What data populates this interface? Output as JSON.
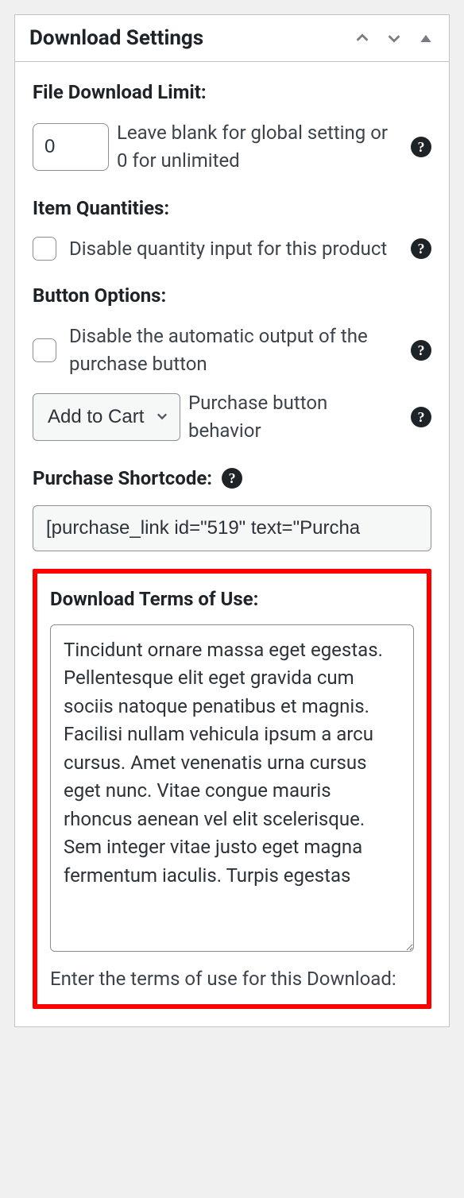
{
  "header": {
    "title": "Download Settings"
  },
  "file_limit": {
    "label": "File Download Limit:",
    "value": "0",
    "desc": "Leave blank for global setting or 0 for unlimited"
  },
  "quantities": {
    "label": "Item Quantities:",
    "checkbox_label": "Disable quantity input for this product"
  },
  "button_options": {
    "label": "Button Options:",
    "checkbox_label": "Disable the automatic output of the purchase button",
    "select_value": "Add to Cart",
    "select_desc": "Purchase button behavior"
  },
  "shortcode": {
    "label": "Purchase Shortcode:",
    "value": "[purchase_link id=\"519\" text=\"Purcha"
  },
  "terms": {
    "label": "Download Terms of Use:",
    "value": "Tincidunt ornare massa eget egestas. Pellentesque elit eget gravida cum sociis natoque penatibus et magnis. Facilisi nullam vehicula ipsum a arcu cursus. Amet venenatis urna cursus eget nunc. Vitae congue mauris rhoncus aenean vel elit scelerisque. Sem integer vitae justo eget magna fermentum iaculis. Turpis egestas",
    "hint": "Enter the terms of use for this Download:"
  }
}
